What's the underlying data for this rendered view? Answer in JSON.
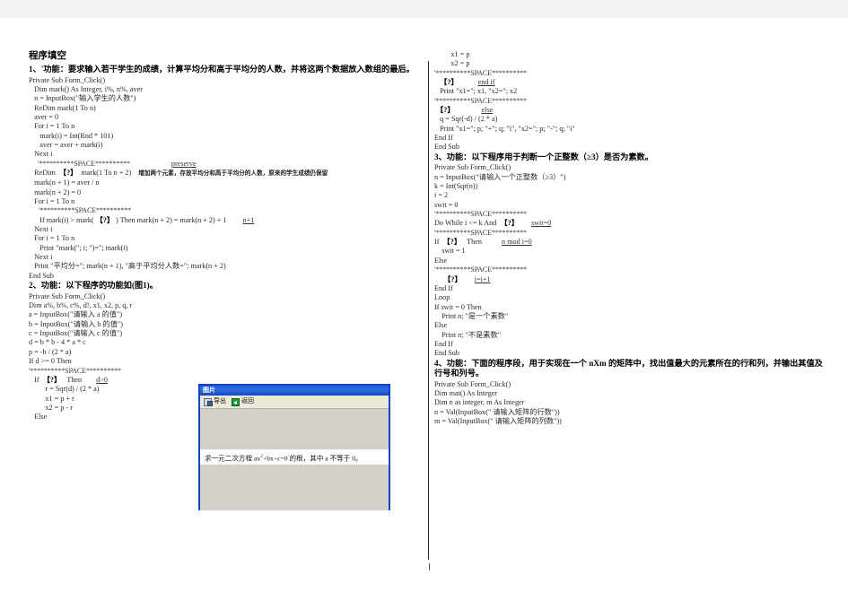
{
  "document": {
    "title": "程序填空"
  },
  "problems": [
    {
      "id": "p1",
      "heading": "1、'功能：要求输入若干学生的成绩，计算平均分和高于平均分的人数，并将这两个数据放入数组的最后。",
      "code": [
        "Private Sub Form_Click()",
        "   Dim mark() As Integer, i%, n%, aver",
        "   n = InputBox(\"输入学生的人数\")",
        "   ReDim mark(1 To n)",
        "   aver = 0",
        "   For i = 1 To n",
        "      mark(i) = Int(Rnd * 101)",
        "      aver = aver + mark(i)",
        "   Next i"
      ],
      "space_marker": "'**********SPACE**********",
      "blank_line_1_prefix": "   ReDim  ",
      "blank_token": "【?】",
      "blank_line_1_suffix": "  mark(1 To n + 2)",
      "answer_1": "preserve",
      "note_1": "增加两个元素，存放平均分和高于平均分的人数，原来的学生成绩仍保留",
      "code2": [
        "   mark(n + 1) = aver / n",
        "   mark(n + 2) = 0",
        "   For i = 1 To n"
      ],
      "space_marker_2": "      '**********SPACE**********",
      "blank_line_2_prefix": "      If mark(i) > mark( ",
      "blank_line_2_suffix": " ) Then mark(n + 2) = mark(n + 2) + 1",
      "answer_2": "n+1",
      "code3": [
        "   Next i",
        "   For i = 1 To n",
        "      Print \"mark(\"; i; \")=\"; mark(i)",
        "   Next i",
        "   Print \"平均分=\"; mark(n + 1), \"高于平均分人数=\"; mark(n + 2)",
        "End Sub"
      ]
    },
    {
      "id": "p2",
      "heading": "2、功能：以下程序的功能如(图1)。",
      "code": [
        "Private Sub Form_Click()",
        "Dim a%, b%, c%, d!, x1, x2, p, q, r",
        "a = InputBox(\"请输入 a 的值\")",
        "b = InputBox(\"请输入 b 的值\")",
        "c = InputBox(\"请输入 c 的值\")",
        "d = b * b - 4 * a * c",
        "p = -b / (2 * a)",
        "If d >= 0 Then"
      ],
      "space_marker": "'**********SPACE**********",
      "blank_line_prefix": "   If  ",
      "blank_token": "【?】",
      "blank_line_suffix": "   Then",
      "answer": "d>0",
      "code2": [
        "         r = Sqr(d) / (2 * a)",
        "         x1 = p + r",
        "         x2 = p - r",
        "   Else"
      ],
      "code_right": [
        "         x1 = p",
        "         x2 = p"
      ],
      "space_marker_r1": "'**********SPACE**********",
      "blank_r1_prefix": "   ",
      "answer_r1": "end if",
      "code_right2": [
        "   Print \"x1=\"; x1, \"x2=\"; x2"
      ],
      "space_marker_r2": "'**********SPACE**********",
      "blank_r2_prefix": " ",
      "answer_r2": "else",
      "code_right3": [
        "   q = Sqr(-d) / (2 * a)",
        "   Print \"x1=\"; p; \"+\"; q; \"i\", \"x2=\"; p; \"-\"; q; \"i\"",
        "End If",
        "End Sub"
      ]
    },
    {
      "id": "p3",
      "heading": "3、功能：以下程序用于判断一个正整数（≥3）是否为素数。",
      "code": [
        "Private Sub Form_Click()",
        "n = InputBox(\"请输入一个正整数（≥3）\")",
        "k = Int(Sqr(n))",
        "i = 2",
        "swit = 0"
      ],
      "space_marker_1": "'**********SPACE**********",
      "blank_1_prefix": "Do While i <= k And  ",
      "blank_token": "【?】",
      "answer_1": "swit=0",
      "space_marker_2": "'**********SPACE**********",
      "blank_2_prefix": "If  ",
      "blank_2_suffix": "   Then",
      "answer_2": "n mod i=0",
      "code2": [
        "    swit = 1",
        "Else"
      ],
      "space_marker_3": "'**********SPACE**********",
      "blank_3_prefix": "     ",
      "answer_3": "i=i+1",
      "code3": [
        "End If",
        "Loop",
        "If swit = 0 Then",
        "    Print n; \"是一个素数\"",
        "Else",
        "    Print n; \"不是素数\"",
        "End If",
        "End Sub"
      ]
    },
    {
      "id": "p4",
      "heading": "4、功能：下面的程序段，用于实现在一个 nXm 的矩阵中，找出值最大的元素所在的行和列，并输出其值及行号和列号。",
      "code": [
        "Private Sub Form_Click()",
        "Dim mat() As Integer",
        "Dim n as integer, m As Integer",
        "n = Val(InputBox(\" 请输入矩阵的行数\"))",
        "m = Val(InputBox(\" 请输入矩阵的列数\"))"
      ]
    }
  ],
  "pic_window": {
    "title": "图片",
    "toolbar": {
      "export_label": "导出",
      "back_label": "返回"
    },
    "caption_prefix": "求一元二次方程 ax",
    "caption_sup": "2",
    "caption_suffix": "+bx+c=0 的根，其中 a 不等于 0。"
  },
  "colors": {
    "window_border": "#1543c8",
    "window_titlebar": "#2a6fe0",
    "window_face": "#d4d0c8",
    "toolbar_face": "#ece9d8",
    "page": "#ffffff",
    "canvas": "#f2f2f2"
  }
}
